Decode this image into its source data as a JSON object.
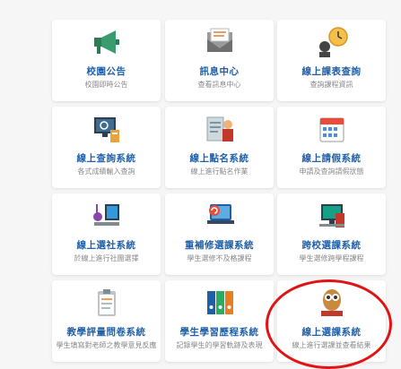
{
  "cards": [
    {
      "title": "校園公告",
      "subtitle": "校園即時公告",
      "icon": "megaphone-icon"
    },
    {
      "title": "訊息中心",
      "subtitle": "查看訊息中心",
      "icon": "mail-envelope-icon"
    },
    {
      "title": "線上課表查詢",
      "subtitle": "查詢課程資訊",
      "icon": "schedule-clock-icon"
    },
    {
      "title": "線上查詢系統",
      "subtitle": "各式成績輸入查詢",
      "icon": "screen-search-icon"
    },
    {
      "title": "線上點名系統",
      "subtitle": "線上進行點名作業",
      "icon": "roll-call-icon"
    },
    {
      "title": "線上請假系統",
      "subtitle": "申請及查詢請假狀態",
      "icon": "calendar-icon"
    },
    {
      "title": "線上選社系統",
      "subtitle": "於線上進行社團選擇",
      "icon": "club-music-icon"
    },
    {
      "title": "重補修選課系統",
      "subtitle": "學生選修不及格課程",
      "icon": "refresh-laptop-icon"
    },
    {
      "title": "跨校選課系統",
      "subtitle": "學生選修跨學程課程",
      "icon": "computer-book-icon"
    },
    {
      "title": "教學評量問卷系統",
      "subtitle": "學生填寫對老師之教學意見反應",
      "icon": "clipboard-survey-icon"
    },
    {
      "title": "學生學習歷程系統",
      "subtitle": "記錄學生的學習軌跡及表現",
      "icon": "binders-icon"
    },
    {
      "title": "線上選課系統",
      "subtitle": "線上進行選課並查看結果",
      "icon": "owl-book-icon"
    }
  ],
  "colors": {
    "title": "#1f5fa8",
    "subtitle": "#888888",
    "highlight": "#e01414"
  }
}
